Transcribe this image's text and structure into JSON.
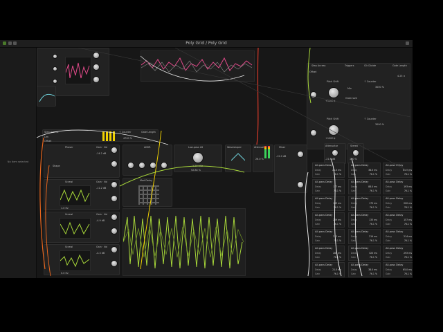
{
  "window": {
    "title": "Poly Grid / Poly Grid"
  },
  "inspector": {
    "empty_text": "No item selected"
  },
  "modules": {
    "step_access_a": {
      "title": "Step Access",
      "offset": "Offset"
    },
    "triggers": {
      "title": "Triggers"
    },
    "clk_divide": {
      "title": "Clk Divide"
    },
    "gate_length_a": {
      "title": "Gate Length",
      "value": "4.25 ×"
    },
    "pitch_shift_1": {
      "title": "Pitch Shift",
      "value": "+1200 ¢",
      "mix": "Mix",
      "grain": "Grain size"
    },
    "pitch_shift_2": {
      "title": "Pitch Shift",
      "value": "+1200 ¢"
    },
    "counter_1": {
      "title": "↑ Counter",
      "value": "3000 %"
    },
    "counter_2": {
      "title": "↑ Counter",
      "value": "3000 %"
    },
    "step_access_b": {
      "title": "Step Access",
      "len": "Len",
      "offset": "Offset"
    },
    "counter_b": {
      "title": "↑ Counter",
      "value": "4700 %"
    },
    "gate_length_b": {
      "title": "Gate Length"
    },
    "phaser": {
      "title": "Phaser",
      "gain": "Gain · Vol",
      "shape": "Shape",
      "value": "-14.2 dB"
    },
    "scrawl_1": {
      "title": "Scrawl",
      "gain": "Gain · Vol",
      "value": "-11.2 dB",
      "freq": "1.0 Hz"
    },
    "scrawl_2": {
      "title": "Scrawl",
      "gain": "Gain · Vol",
      "value": "-4.9 dB"
    },
    "scrawl_3": {
      "title": "Scrawl",
      "gain": "Gain · Vol",
      "value": "-4.3 dB",
      "freq": "0.0 Hz"
    },
    "adsr": {
      "title": "ADSR"
    },
    "mod_delay": {
      "title": "Mod Delay"
    },
    "lowpass": {
      "title": "Low-pass LD",
      "freq": "1.20 kHz",
      "res": "52.84 %"
    },
    "waveshaper": {
      "title": "Waveshaper"
    },
    "attenuator_a": {
      "title": "Attenuator",
      "value": "26.0 %"
    },
    "mixer": {
      "title": "Mixer",
      "value": "-12.0 dB"
    },
    "attenuator_b": {
      "title": "Attenuator",
      "value": "-21.0 dB"
    },
    "stereo": {
      "title": "Stereo",
      "value": "100 %"
    }
  },
  "all_pass": {
    "title": "All-pass Delay",
    "delay_label": "Delay",
    "gain_label": "Gain",
    "columns": [
      [
        {
          "delay": "21.0 ms",
          "gain": "76.1 %"
        },
        {
          "delay": "177 ms",
          "gain": "76.1 %"
        },
        {
          "delay": "163 ms",
          "gain": "76.1 %"
        },
        {
          "delay": "209 ms",
          "gain": "76.1 %"
        },
        {
          "delay": "212 ms",
          "gain": "76.1 %"
        },
        {
          "delay": "283 ms",
          "gain": "76.1 %"
        },
        {
          "delay": "21.0 ms",
          "gain": "76.1 %"
        }
      ],
      [
        {
          "delay": "38.0 ms",
          "gain": "76.1 %"
        },
        {
          "delay": "88.0 ms",
          "gain": "76.1 %"
        },
        {
          "delay": "175 ms",
          "gain": "76.1 %"
        },
        {
          "delay": "133 ms",
          "gain": "76.1 %"
        },
        {
          "delay": "219 ms",
          "gain": "76.1 %"
        },
        {
          "delay": "320 ms",
          "gain": "76.1 %"
        },
        {
          "delay": "38.0 ms",
          "gain": "76.1 %"
        }
      ],
      [
        {
          "delay": "65.0 ms",
          "gain": "76.1 %"
        },
        {
          "delay": "193 ms",
          "gain": "76.1 %"
        },
        {
          "delay": "200 ms",
          "gain": "76.1 %"
        },
        {
          "delay": "157 ms",
          "gain": "76.1 %"
        },
        {
          "delay": "214 ms",
          "gain": "76.1 %"
        },
        {
          "delay": "293 ms",
          "gain": "76.1 %"
        },
        {
          "delay": "65.0 ms",
          "gain": "76.1 %"
        }
      ]
    ]
  },
  "colors": {
    "accent_green": "#a9d93a",
    "accent_yellow": "#f0d000",
    "accent_pink": "#e24a8a",
    "cable_white": "#e8e8e8",
    "cable_orange": "#e8661d",
    "cable_red": "#d83a2a"
  }
}
